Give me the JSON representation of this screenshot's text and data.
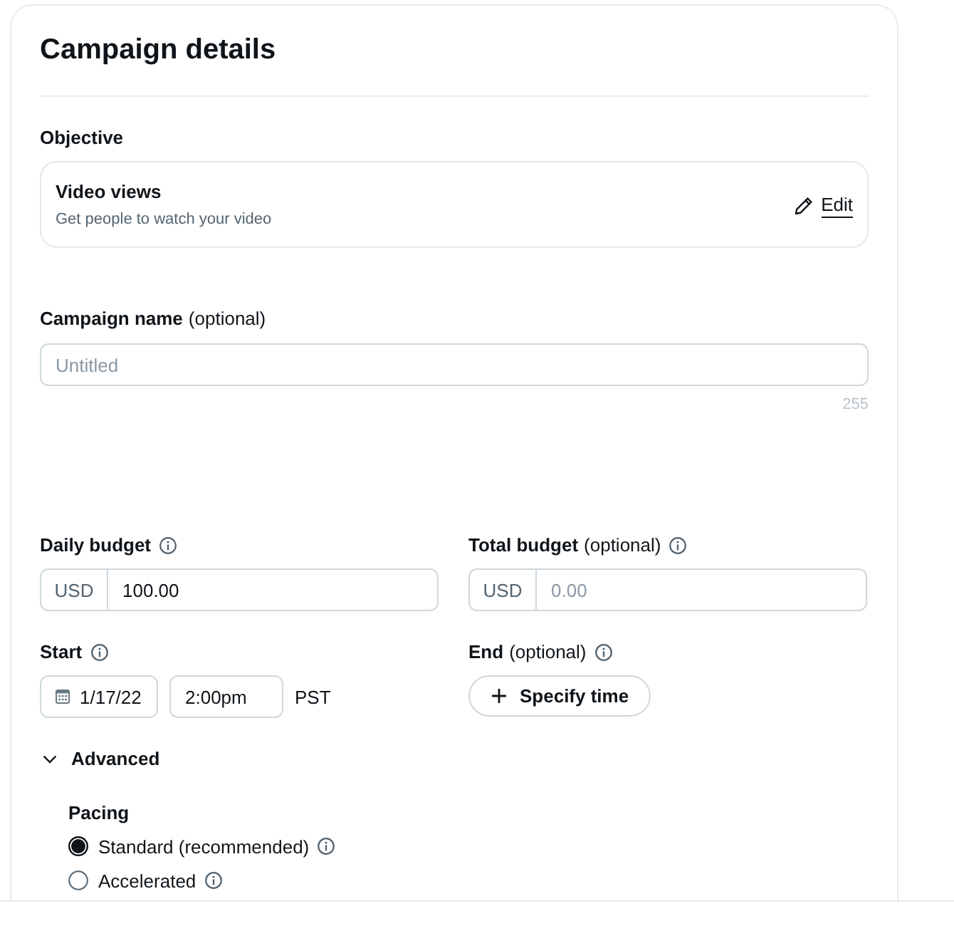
{
  "title": "Campaign details",
  "objective": {
    "label": "Objective",
    "name": "Video views",
    "description": "Get people to watch your video",
    "action": "Edit"
  },
  "campaign_name": {
    "label": "Campaign name",
    "note": "(optional)",
    "placeholder": "Untitled",
    "counter": "255"
  },
  "budgets": [
    {
      "label": "Daily budget",
      "info": true,
      "currency": "USD",
      "value": "100.00"
    },
    {
      "label": "Total budget",
      "note": "(optional)",
      "info": true,
      "currency": "USD",
      "placeholder": "0.00"
    }
  ],
  "start": {
    "label": "Start",
    "info": true,
    "date": "1/17/22",
    "time": "2:00pm",
    "timezone": "PST"
  },
  "end": {
    "label": "End",
    "note": "(optional)",
    "info": true,
    "button": "Specify time"
  },
  "advanced": {
    "label": "Advanced",
    "expanded": true,
    "pacing": {
      "label": "Pacing",
      "options": [
        {
          "label": "Standard (recommended)",
          "selected": true,
          "info": true
        },
        {
          "label": "Accelerated",
          "selected": false,
          "info": true
        }
      ]
    }
  }
}
